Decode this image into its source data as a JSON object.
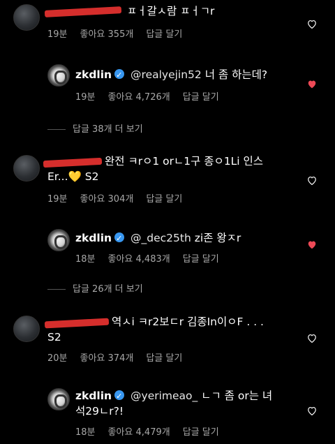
{
  "comments": [
    {
      "text": "ㅍㅓ갈ㅅ람 ㅍㅓㄱr",
      "time": "19분",
      "likes": "좋아요 355개",
      "reply": "답글 달기",
      "reply_item": {
        "username": "zkdlin",
        "mention": "@realyejin52",
        "text": "너 좀 하는데?",
        "time": "19분",
        "likes": "좋아요 4,726개",
        "reply": "답글 달기"
      },
      "more": "답글 38개 더 보기"
    },
    {
      "text_line1": "완전 ㅋrㅇ1 orㄴ1구 종ㅇ1Li 인스",
      "text_line2": "Er...",
      "emoji": "💛",
      "text_tail": "S2",
      "time": "19분",
      "likes": "좋아요 304개",
      "reply": "답글 달기",
      "reply_item": {
        "username": "zkdlin",
        "mention": "@_dec25th",
        "text": "zi존 왕ㅈr",
        "time": "18분",
        "likes": "좋아요 4,483개",
        "reply": "답글 달기"
      },
      "more": "답글 26개 더 보기"
    },
    {
      "text_line1": "역ㅅi ㅋr2보ㄷr 김종In이ㅇF . . .",
      "text_line2": "S2",
      "time": "20분",
      "likes": "좋아요 374개",
      "reply": "답글 달기",
      "reply_item": {
        "username": "zkdlin",
        "mention": "@yerimeao_",
        "text_line1": "ㄴㄱ 좀 or는 녀",
        "text_line2": "석29ㄴr?!",
        "time": "18분",
        "likes": "좋아요 4,479개",
        "reply": "답글 달기"
      }
    }
  ],
  "colors": {
    "liked": "#ed4956",
    "verified": "#3897f0",
    "meta": "#a8a8a8"
  },
  "icons": {
    "like": "heart-icon",
    "verified": "verified-badge-icon"
  }
}
